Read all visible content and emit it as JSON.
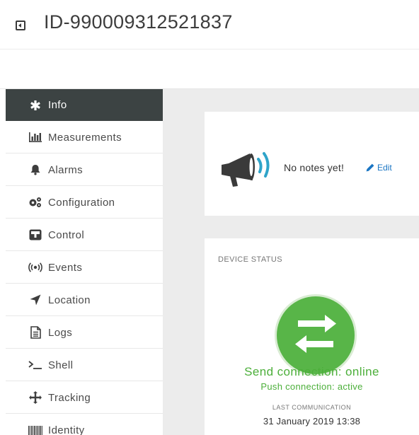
{
  "header": {
    "device_id": "ID-990009312521837",
    "icon": "device-icon"
  },
  "sidebar": {
    "items": [
      {
        "label": "Info",
        "icon": "asterisk-icon",
        "active": true
      },
      {
        "label": "Measurements",
        "icon": "bar-chart-icon",
        "active": false
      },
      {
        "label": "Alarms",
        "icon": "bell-icon",
        "active": false
      },
      {
        "label": "Configuration",
        "icon": "gears-icon",
        "active": false
      },
      {
        "label": "Control",
        "icon": "control-icon",
        "active": false
      },
      {
        "label": "Events",
        "icon": "broadcast-icon",
        "active": false
      },
      {
        "label": "Location",
        "icon": "location-arrow-icon",
        "active": false
      },
      {
        "label": "Logs",
        "icon": "document-icon",
        "active": false
      },
      {
        "label": "Shell",
        "icon": "terminal-icon",
        "active": false
      },
      {
        "label": "Tracking",
        "icon": "crosshair-icon",
        "active": false
      },
      {
        "label": "Identity",
        "icon": "barcode-icon",
        "active": false
      }
    ]
  },
  "notes": {
    "text": "No notes yet!",
    "edit_label": "Edit"
  },
  "device_status": {
    "label": "DEVICE STATUS",
    "send_connection": "Send connection: online",
    "push_connection": "Push connection: active",
    "last_communication_label": "LAST COMMUNICATION",
    "last_communication_value": "31 January 2019 13:38"
  },
  "colors": {
    "active_nav": "#3c4343",
    "status_green": "#58b548",
    "status_text_green": "#4caf3a",
    "link_blue": "#1b76c4",
    "megaphone_accent": "#2fa4c9"
  }
}
